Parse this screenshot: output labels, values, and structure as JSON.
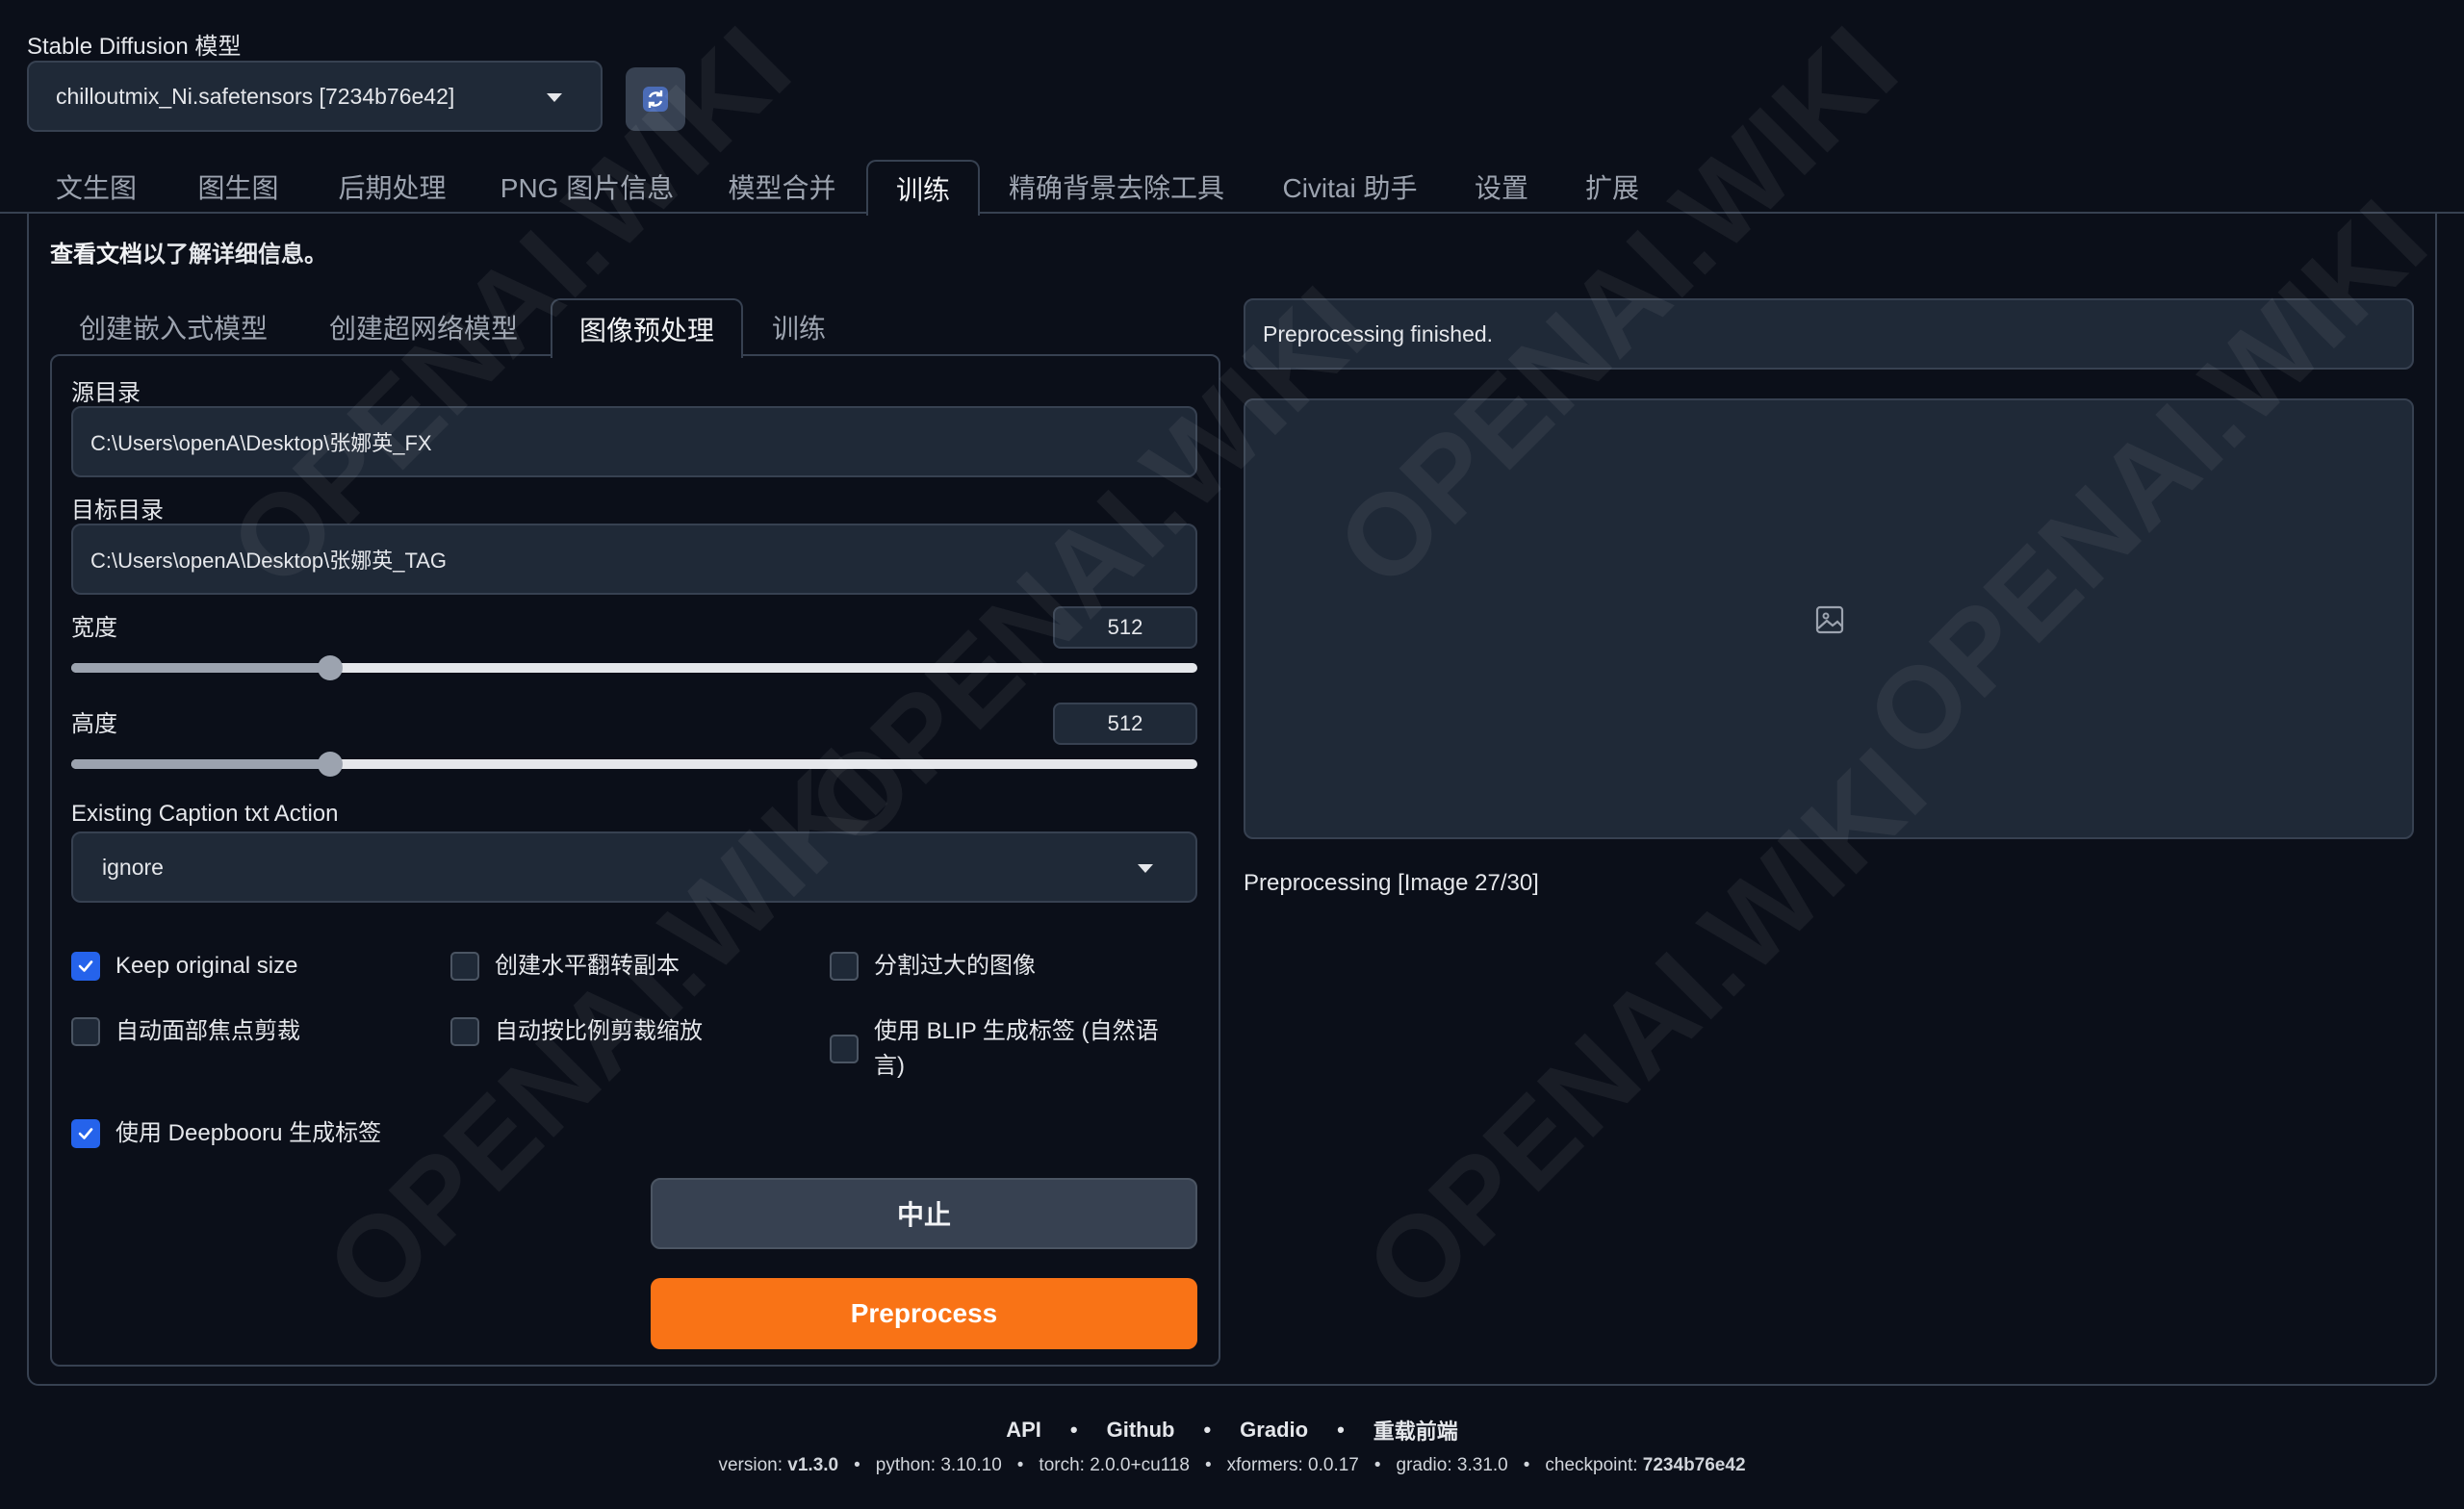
{
  "model": {
    "label": "Stable Diffusion 模型",
    "value": "chilloutmix_Ni.safetensors [7234b76e42]"
  },
  "tabs": [
    "文生图",
    "图生图",
    "后期处理",
    "PNG 图片信息",
    "模型合并",
    "训练",
    "精确背景去除工具",
    "Civitai 助手",
    "设置",
    "扩展"
  ],
  "info": {
    "link": "查看文档",
    "text": "以了解详细信息。"
  },
  "subtabs": [
    "创建嵌入式模型",
    "创建超网络模型",
    "图像预处理",
    "训练"
  ],
  "form": {
    "source_label": "源目录",
    "source_value": "C:\\Users\\openA\\Desktop\\张娜英_FX",
    "dest_label": "目标目录",
    "dest_value": "C:\\Users\\openA\\Desktop\\张娜英_TAG",
    "width": {
      "label": "宽度",
      "value": "512",
      "fraction": 0.23
    },
    "height": {
      "label": "高度",
      "value": "512",
      "fraction": 0.23
    },
    "caption_label": "Existing Caption txt Action",
    "caption_value": "ignore"
  },
  "checkboxes": {
    "keep_size": {
      "label": "Keep original size",
      "checked": true
    },
    "flip": {
      "label": "创建水平翻转副本",
      "checked": false
    },
    "split": {
      "label": "分割过大的图像",
      "checked": false
    },
    "face": {
      "label": "自动面部焦点剪裁",
      "checked": false
    },
    "auto_crop": {
      "label": "自动按比例剪裁缩放",
      "checked": false
    },
    "blip": {
      "label": "使用 BLIP 生成标签 (自然语言)",
      "checked": false
    },
    "deepbooru": {
      "label": "使用 Deepbooru 生成标签",
      "checked": true
    }
  },
  "buttons": {
    "interrupt": "中止",
    "preprocess": "Preprocess"
  },
  "output": {
    "status": "Preprocessing finished.",
    "progress": "Preprocessing [Image 27/30]"
  },
  "footer": {
    "links": [
      "API",
      "Github",
      "Gradio",
      "重载前端"
    ],
    "version_label": "version: ",
    "version": "v1.3.0",
    "python": "python: 3.10.10",
    "torch": "torch: 2.0.0+cu118",
    "xformers": "xformers: 0.0.17",
    "gradio": "gradio: 3.31.0",
    "checkpoint_label": "checkpoint: ",
    "checkpoint": "7234b76e42"
  },
  "watermark": "OPENAI.WIKI",
  "colors": {
    "accent": "#f97316",
    "checkbox": "#2563eb",
    "background": "#0b0f19"
  }
}
